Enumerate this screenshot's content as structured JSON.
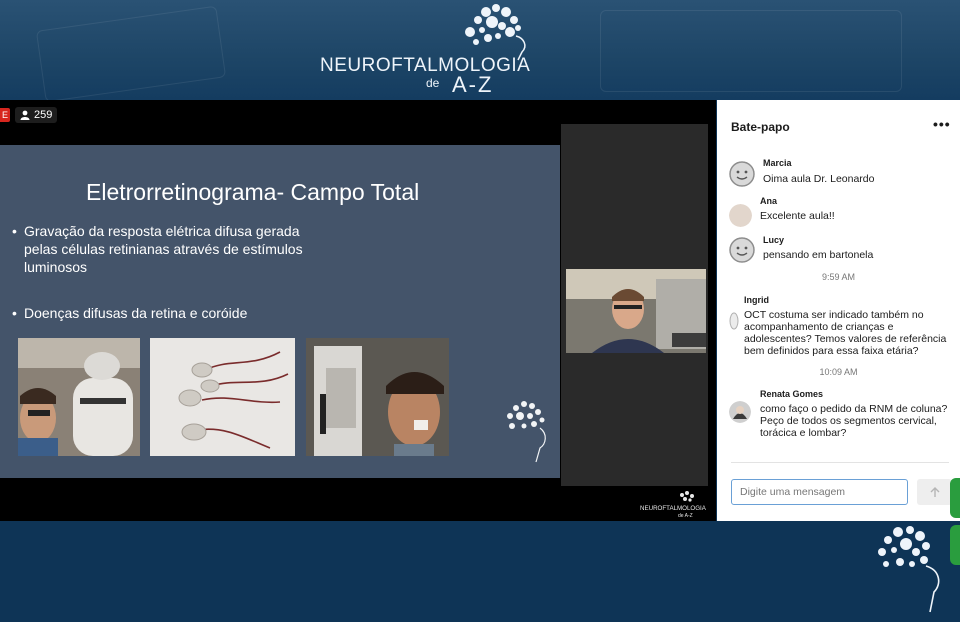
{
  "banner": {
    "brand_line1": "NEUROFTALMOLOGIA",
    "brand_de": "de",
    "brand_az": "A-Z"
  },
  "stage": {
    "live_label": "E",
    "viewer_count": "259"
  },
  "slide": {
    "title": "Eletrorretinograma- Campo Total",
    "bullet_symbol": "•",
    "bullets": [
      "Gravação da resposta elétrica difusa gerada pelas células retinianas através de estímulos luminosos",
      "Doenças difusas da retina e coróide"
    ]
  },
  "chat": {
    "title": "Bate-papo",
    "more_label": "•••",
    "input_placeholder": "Digite uma mensagem",
    "messages": [
      {
        "name": "Marcia",
        "text": "Oima aula Dr. Leonardo"
      },
      {
        "name": "Ana",
        "text": "Excelente aula!!"
      },
      {
        "name": "Lucy",
        "text": "pensando em bartonela"
      },
      {
        "name": "Ingrid",
        "text": "OCT costuma ser indicado também no acompanhamento de crianças e adolescentes? Temos valores de referência bem definidos para essa faixa etária?"
      },
      {
        "name": "Renata Gomes",
        "text": "como faço o pedido da RNM de coluna? Peço de todos os segmentos cervical, torácica e lombar?"
      }
    ],
    "timestamps": [
      "9:59 AM",
      "10:09 AM"
    ]
  },
  "colors": {
    "banner_bg": "#1d4566",
    "page_bg": "#0e3456",
    "slide_bg": "#44546a",
    "live_red": "#d7261e",
    "side_tab_green": "#2a9d3e",
    "input_border": "#6aa0d6"
  },
  "icons": {
    "viewer": "person-icon",
    "send": "arrow-up-icon",
    "more": "more-horizontal-icon",
    "avatar_default": "smiley-avatar-icon"
  }
}
